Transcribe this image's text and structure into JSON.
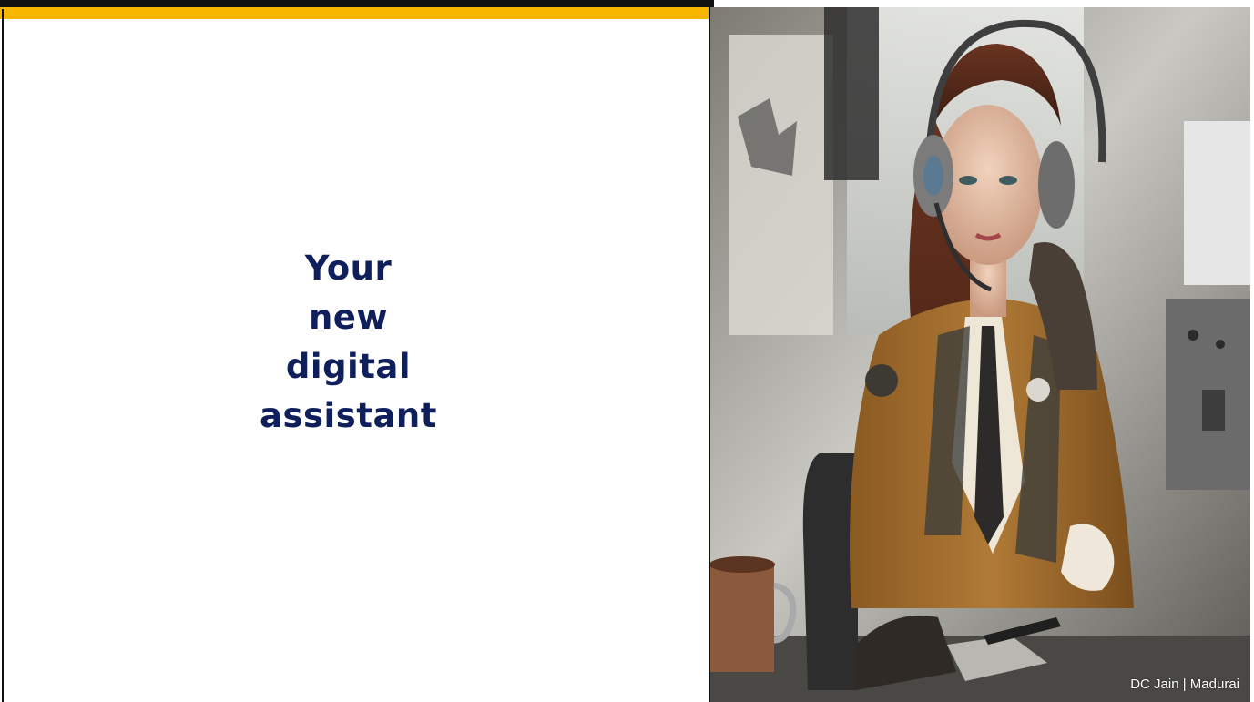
{
  "slide": {
    "title_lines": [
      "Your",
      "new",
      "digital",
      "assistant"
    ],
    "caption": "DC Jain | Madurai"
  },
  "colors": {
    "accent": "#F7B500",
    "title": "#0F1F5C",
    "background": "#FFFFFF"
  }
}
